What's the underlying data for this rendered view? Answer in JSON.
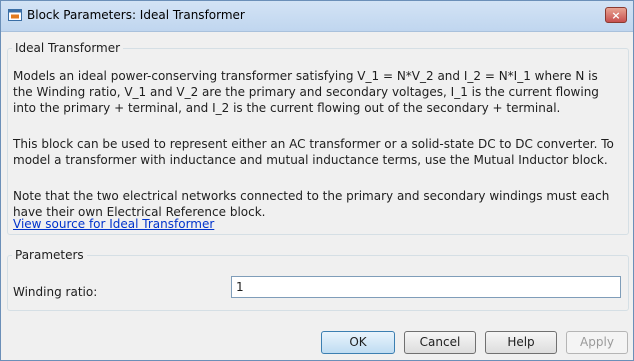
{
  "window": {
    "title": "Block Parameters: Ideal Transformer",
    "close_glyph": "×"
  },
  "block": {
    "group_title": "Ideal Transformer",
    "paragraph_1": "Models an ideal power-conserving transformer satisfying V_1 = N*V_2 and I_2 = N*I_1 where N is the Winding ratio, V_1 and V_2 are the primary and secondary voltages, I_1 is the current flowing into the primary + terminal, and I_2 is the current flowing out of the secondary + terminal.",
    "paragraph_2": "This block can be used to represent either an AC transformer or a solid-state DC to DC converter. To model a transformer with inductance and mutual inductance terms, use the Mutual Inductor block.",
    "paragraph_3": "Note that the two electrical networks connected to the primary and secondary windings must each have their own Electrical Reference block.",
    "source_link": "View source for Ideal Transformer"
  },
  "parameters": {
    "group_title": "Parameters",
    "winding_ratio_label": "Winding ratio:",
    "winding_ratio_value": "1"
  },
  "buttons": {
    "ok": "OK",
    "cancel": "Cancel",
    "help": "Help",
    "apply": "Apply"
  },
  "icons": {
    "app": "simulink-block-icon",
    "close": "close-icon"
  }
}
